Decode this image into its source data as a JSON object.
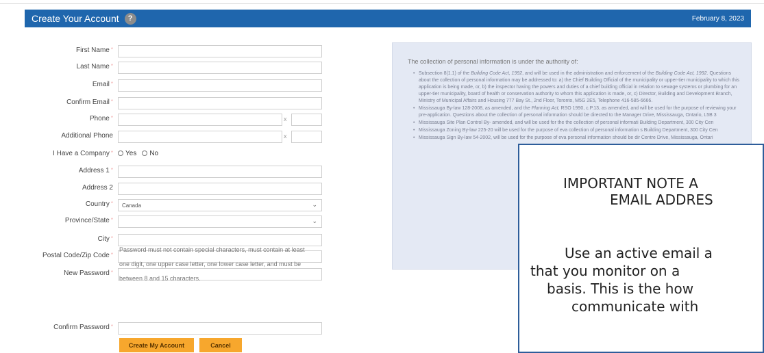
{
  "header": {
    "title": "Create Your Account",
    "help_icon": "question-icon",
    "date": "February 8, 2023"
  },
  "form": {
    "first_name_label": "First Name",
    "last_name_label": "Last Name",
    "email_label": "Email",
    "confirm_email_label": "Confirm Email",
    "phone_label": "Phone",
    "phone_ext_separator": "x",
    "additional_phone_label": "Additional Phone",
    "additional_phone_ext_separator": "x",
    "has_company_label": "I Have a Company",
    "yes_label": "Yes",
    "no_label": "No",
    "address1_label": "Address 1",
    "address2_label": "Address 2",
    "country_label": "Country",
    "country_value": "Canada",
    "province_label": "Province/State",
    "city_label": "City",
    "postal_label": "Postal Code/Zip Code",
    "new_password_label": "New Password",
    "password_help_1": "Password must not contain special characters, must contain at least",
    "password_help_2": "one digit, one upper case letter, one lower case letter, and must be",
    "password_help_3": "between 8 and 15 characters.",
    "confirm_password_label": "Confirm Password",
    "required_marker": "*",
    "create_button": "Create My Account",
    "cancel_button": "Cancel"
  },
  "privacy": {
    "intro": "The collection of personal information is under the authority of:",
    "items": [
      {
        "a": "Subsection 8(1.1) of the ",
        "b": "Building Code Act, 1992",
        "c": ", and will be used in the administration and enforcement of the ",
        "d": "Building Code Act, 1992",
        "e": ". Questions about the collection of personal information may be addressed to: a) the Chief Building Official of the municipality or upper-tier municipality to which this application is being made, or, b) the inspector having the powers and duties of a chief building official in relation to sewage systems or plumbing for an upper-tier municipality, board of health or conservation authority to whom this application is made, or, c) Director, Building and Development Branch, Ministry of Municipal Affairs and Housing 777 Bay St., 2nd Floor, Toronto, M5G 2E5, Telephone 416-585-6666."
      },
      {
        "a": "Mississauga By-law 128-2008, as amended, and the ",
        "b": "Planning Act",
        "c": ", RSO 1990, c.P.13, as amended, and will be used for the purpose of reviewing your pre-application. Questions about the collection of personal information should be directed to the Manager",
        "d": "",
        "e": " Drive, Mississauga, Ontario, L5B 3"
      },
      {
        "a": "Mississauga Site Plan Control By-",
        "b": "",
        "c": " amended, and will be used for the",
        "d": "",
        "e": " the collection of personal informati Building Department, 300 City Cen"
      },
      {
        "a": "Mississauga Zoning By-law 225-20",
        "b": "",
        "c": " will be used for the purpose of eva",
        "d": "",
        "e": " collection of personal information s Building Department, 300 City Cen"
      },
      {
        "a": "Mississauga Sign By-law 54-2002,",
        "b": "",
        "c": " will be used for the purpose of eva",
        "d": "",
        "e": " personal information should be dir Centre Drive, Mississauga, Ontari"
      }
    ]
  },
  "important": {
    "line1": "IMPORTANT NOTE A",
    "line2": "EMAIL ADDRES",
    "line3": "Use an active email a",
    "line4": "that you monitor on a",
    "line5": "basis. This is the how",
    "line6": "communicate with"
  }
}
